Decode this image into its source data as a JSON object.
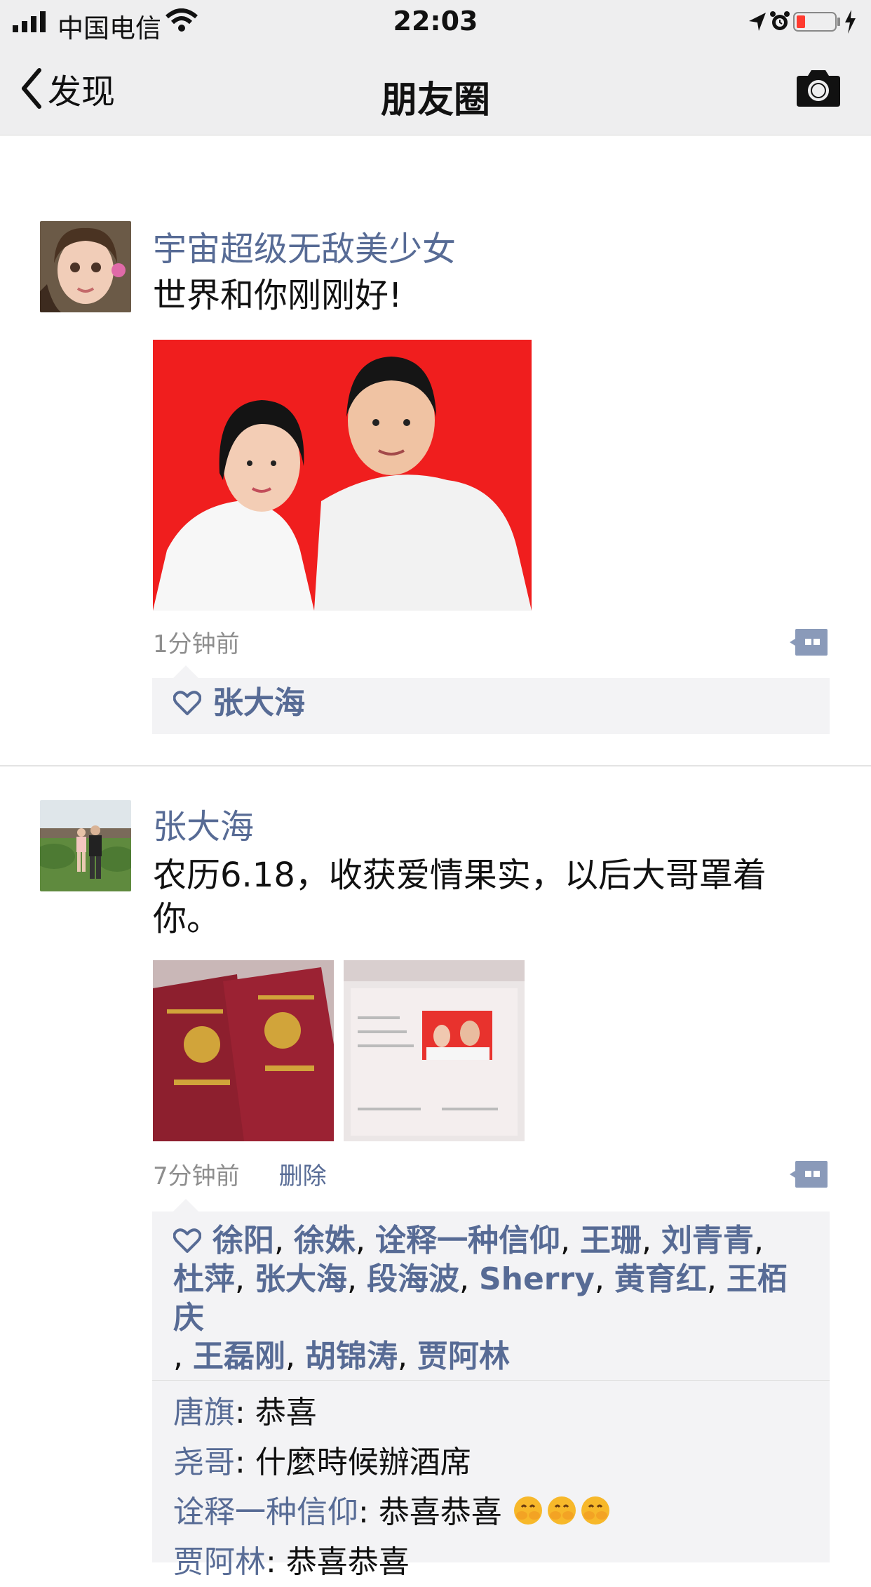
{
  "status_bar": {
    "carrier": "中国电信",
    "time": "22:03"
  },
  "nav": {
    "back_label": "发现",
    "title": "朋友圈"
  },
  "posts": [
    {
      "author": "宇宙超级无敌美少女",
      "text": "世界和你刚刚好!",
      "time": "1分钟前",
      "likes": [
        "张大海"
      ]
    },
    {
      "author": "张大海",
      "text": "农历6.18，收获爱情果实，以后大哥罩着你。",
      "time": "7分钟前",
      "delete_label": "删除",
      "likes": [
        "徐阳",
        "徐姝",
        "诠释一种信仰",
        "王珊",
        "刘青青",
        "杜萍",
        "张大海",
        "段海波",
        "Sherry",
        "黄育红",
        "王栢庆",
        "王磊刚",
        "胡锦涛",
        "贾阿林"
      ],
      "comments": [
        {
          "name": "唐旗",
          "text": "恭喜"
        },
        {
          "name": "尧哥",
          "text": "什麼時候辦酒席"
        },
        {
          "name": "诠释一种信仰",
          "text": "恭喜恭喜",
          "emoji_count": 3
        },
        {
          "name": "贾阿林",
          "text": "恭喜恭喜"
        }
      ]
    }
  ],
  "colors": {
    "link": "#576b95",
    "bar": "#eeeeef",
    "battery_low": "#ff3b30"
  },
  "icons": [
    "signal-icon",
    "wifi-icon",
    "location-icon",
    "alarm-icon",
    "battery-icon",
    "charging-icon",
    "back-chevron-icon",
    "camera-icon",
    "comment-icon",
    "heart-icon",
    "emoji-icon"
  ]
}
